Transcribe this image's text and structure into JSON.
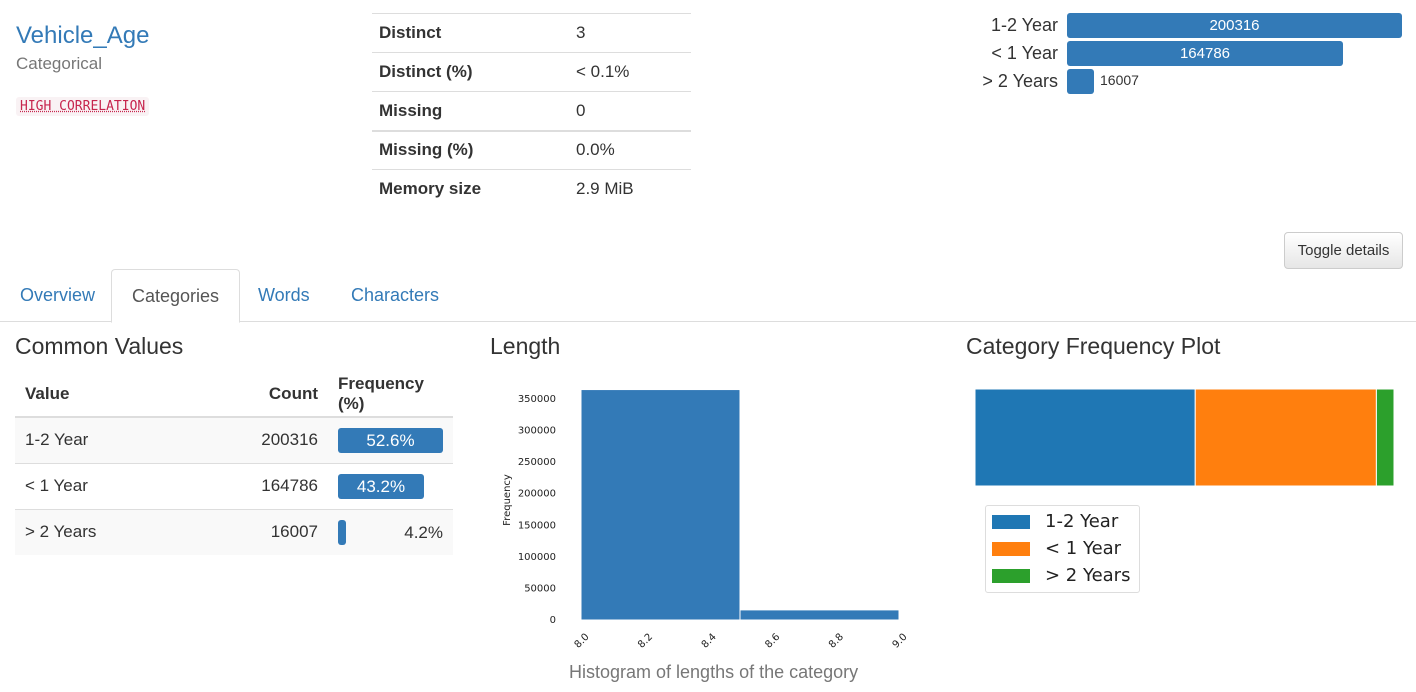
{
  "variable": {
    "name": "Vehicle_Age",
    "type": "Categorical",
    "badge": "HIGH CORRELATION"
  },
  "stats": [
    {
      "label": "Distinct",
      "value": "3"
    },
    {
      "label": "Distinct (%)",
      "value": "< 0.1%"
    },
    {
      "label": "Missing",
      "value": "0"
    },
    {
      "label": "Missing (%)",
      "value": "0.0%"
    },
    {
      "label": "Memory size",
      "value": "2.9 MiB"
    }
  ],
  "mini_freq": [
    {
      "label": "1-2 Year",
      "count": 200316,
      "text": "200316"
    },
    {
      "label": "< 1 Year",
      "count": 164786,
      "text": "164786"
    },
    {
      "label": "> 2 Years",
      "count": 16007,
      "text": "16007"
    }
  ],
  "toggle_label": "Toggle details",
  "tabs": [
    "Overview",
    "Categories",
    "Words",
    "Characters"
  ],
  "active_tab": "Categories",
  "common_values": {
    "title": "Common Values",
    "headers": [
      "Value",
      "Count",
      "Frequency (%)"
    ],
    "rows": [
      {
        "value": "1-2 Year",
        "count": "200316",
        "freq": "52.6%",
        "pct": 52.6
      },
      {
        "value": "< 1 Year",
        "count": "164786",
        "freq": "43.2%",
        "pct": 43.2
      },
      {
        "value": "> 2 Years",
        "count": "16007",
        "freq": "4.2%",
        "pct": 4.2
      }
    ]
  },
  "length_panel": {
    "title": "Length",
    "caption": "Histogram of lengths of the category"
  },
  "freq_plot_panel": {
    "title": "Category Frequency Plot"
  },
  "colors": {
    "accent": "#337ab7",
    "series": [
      "#1f77b4",
      "#ff7f0e",
      "#2ca02c"
    ]
  },
  "chart_data": [
    {
      "type": "bar",
      "title": "",
      "xlabel": "",
      "ylabel": "Frequency",
      "bins": [
        [
          8.0,
          8.5
        ],
        [
          8.5,
          9.0
        ]
      ],
      "values": [
        364852,
        16007
      ],
      "xlim": [
        8.0,
        9.0
      ],
      "ylim": [
        0,
        380000
      ],
      "xticks": [
        "8.0",
        "8.2",
        "8.4",
        "8.6",
        "8.8",
        "9.0"
      ],
      "yticks": [
        "0",
        "50000",
        "100000",
        "150000",
        "200000",
        "250000",
        "300000",
        "350000"
      ],
      "grid": false
    },
    {
      "type": "bar",
      "stacked": true,
      "orientation": "horizontal",
      "series": [
        {
          "name": "1-2 Year",
          "values": [
            200316
          ]
        },
        {
          "name": "< 1 Year",
          "values": [
            164786
          ]
        },
        {
          "name": "> 2 Years",
          "values": [
            16007
          ]
        }
      ],
      "legend": "bottom-left",
      "grid": false
    }
  ]
}
